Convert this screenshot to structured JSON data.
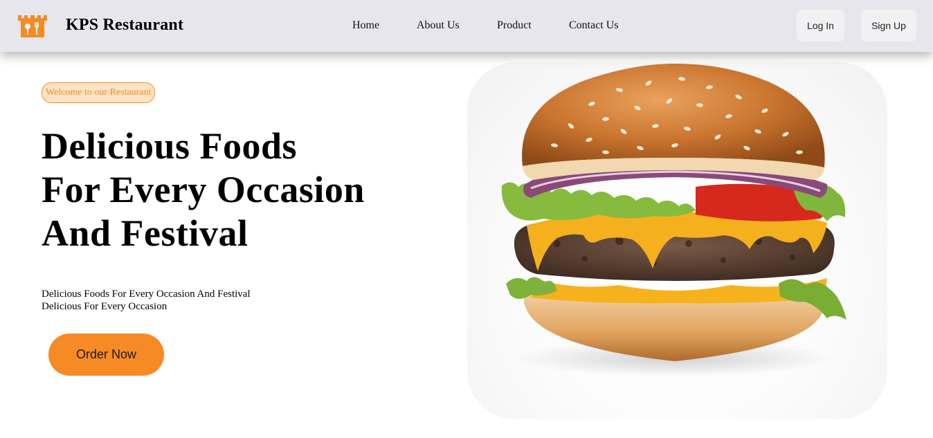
{
  "header": {
    "logo_icon": "restaurant-logo-icon",
    "brand": "KPS Restaurant",
    "nav": [
      "Home",
      "About Us",
      "Product",
      "Contact Us"
    ],
    "login_label": "Log In",
    "signup_label": "Sign Up"
  },
  "hero": {
    "badge": "Welcome to our Restaurant",
    "headline": [
      "Delicious Foods",
      "For Every Occasion",
      "And Festival"
    ],
    "description": [
      "Delicious Foods For Every Occasion And Festival",
      "Delicious For Every Occasion"
    ],
    "cta_label": "Order Now",
    "image": "burger-image"
  },
  "colors": {
    "accent": "#f68a24",
    "badge_bg": "#fde2c6",
    "navbar_bg": "#e6e6ec"
  }
}
